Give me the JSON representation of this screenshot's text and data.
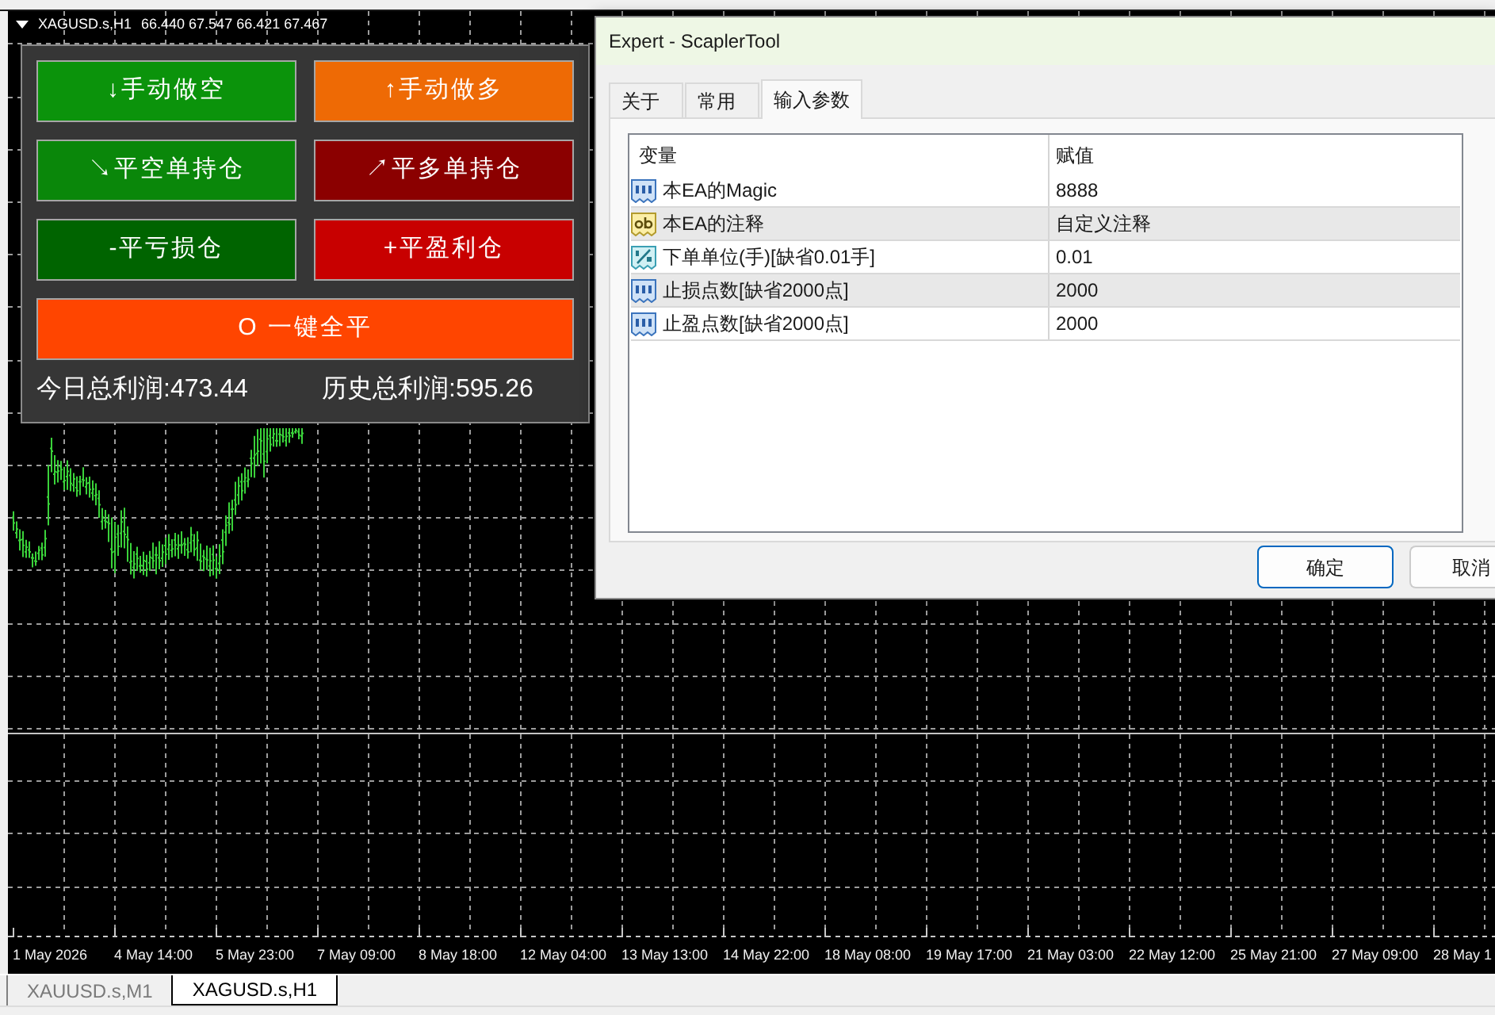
{
  "chart": {
    "symbol": "XAGUSD.s,H1",
    "ohlc": "66.440 67.547 66.421 67.467",
    "time_labels": [
      "1 May 2026",
      "4 May 14:00",
      "5 May 23:00",
      "7 May 09:00",
      "8 May 18:00",
      "12 May 04:00",
      "13 May 13:00",
      "14 May 22:00",
      "18 May 08:00",
      "19 May 17:00",
      "21 May 03:00",
      "22 May 12:00",
      "25 May 21:00",
      "27 May 09:00",
      "28 May 1"
    ]
  },
  "trade_panel": {
    "buttons": [
      {
        "label": "↓手动做空",
        "color": "#0b930b"
      },
      {
        "label": "↑手动做多",
        "color": "#ee6a05"
      },
      {
        "label": "↘平空单持仓",
        "color": "#0a870a"
      },
      {
        "label": "↗平多单持仓",
        "color": "#8b0000"
      },
      {
        "label": "-平亏损仓",
        "color": "#006400"
      },
      {
        "label": "+平盈利仓",
        "color": "#c80000"
      },
      {
        "label": "O 一键全平",
        "color": "#ff4500"
      }
    ],
    "stats": [
      "今日总利润:473.44",
      "历史总利润:595.26"
    ]
  },
  "dialog": {
    "title": "Expert - ScaplerTool",
    "tabs": [
      {
        "label": "关于",
        "selected": false
      },
      {
        "label": "常用",
        "selected": false
      },
      {
        "label": "输入参数",
        "selected": true
      }
    ],
    "table": {
      "columns": [
        "变量",
        "赋值"
      ],
      "rows": [
        {
          "kind": "int",
          "name": "本EA的Magic",
          "value": "8888"
        },
        {
          "kind": "string",
          "name": "本EA的注释",
          "value": "自定义注释"
        },
        {
          "kind": "double",
          "name": "下单单位(手)[缺省0.01手]",
          "value": "0.01"
        },
        {
          "kind": "int",
          "name": "止损点数[缺省2000点]",
          "value": "2000"
        },
        {
          "kind": "int",
          "name": "止盈点数[缺省2000点]",
          "value": "2000"
        }
      ]
    },
    "buttons": [
      {
        "label": "确定",
        "default": true
      },
      {
        "label": "取消",
        "default": false
      }
    ]
  },
  "chart_tabs": [
    {
      "label": "XAUUSD.s,M1",
      "selected": false
    },
    {
      "label": "XAGUSD.s,H1",
      "selected": true
    }
  ]
}
